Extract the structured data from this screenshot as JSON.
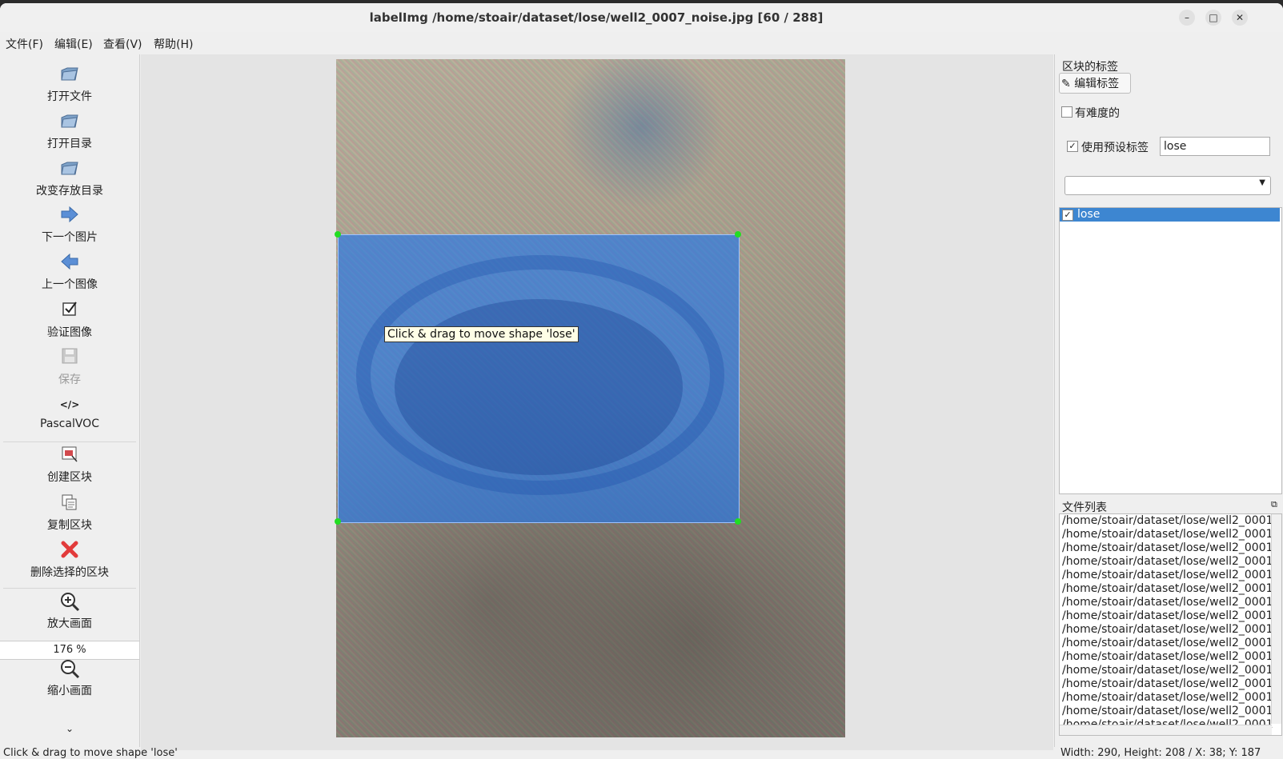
{
  "window": {
    "title": "labelImg /home/stoair/dataset/lose/well2_0007_noise.jpg [60 / 288]",
    "minimize_icon": "–",
    "maximize_icon": "□",
    "close_icon": "✕"
  },
  "menu": [
    "文件(F)",
    "编辑(E)",
    "查看(V)",
    "帮助(H)"
  ],
  "toolbar": {
    "open_file": {
      "label": "打开文件",
      "icon": "folder-icon"
    },
    "open_dir": {
      "label": "打开目录",
      "icon": "folder-icon"
    },
    "change_save_dir": {
      "label": "改变存放目录",
      "icon": "folder-icon"
    },
    "next_image": {
      "label": "下一个图片",
      "icon": "arrow-right-icon"
    },
    "prev_image": {
      "label": "上一个图像",
      "icon": "arrow-left-icon"
    },
    "verify": {
      "label": "验证图像",
      "icon": "checkbox-icon"
    },
    "save": {
      "label": "保存",
      "icon": "save-icon"
    },
    "format": {
      "label": "PascalVOC",
      "icon": "</>"
    },
    "create_box": {
      "label": "创建区块",
      "icon": "create-box-icon"
    },
    "duplicate_box": {
      "label": "复制区块",
      "icon": "copy-icon"
    },
    "delete_box": {
      "label": "删除选择的区块",
      "icon": "delete-icon"
    },
    "zoom_in": {
      "label": "放大画面",
      "icon": "zoom-in-icon"
    },
    "zoom_value": "176 %",
    "zoom_out": {
      "label": "缩小画面",
      "icon": "zoom-out-icon"
    },
    "more_icon": "⌄"
  },
  "canvas": {
    "tooltip": "Click & drag to move shape 'lose'",
    "box_color": "#2878e6"
  },
  "right_panel": {
    "box_labels_title": "区块的标签",
    "edit_label_button": "编辑标签",
    "difficult_label": "有难度的",
    "difficult_checked": false,
    "use_default_label": "使用预设标签",
    "use_default_checked": true,
    "default_label_value": "lose",
    "combo_value": "",
    "labels": [
      {
        "text": "lose",
        "checked": true,
        "selected": true
      }
    ],
    "file_list_title": "文件列表",
    "files": [
      "/home/stoair/dataset/lose/well2_0001",
      "/home/stoair/dataset/lose/well2_0001",
      "/home/stoair/dataset/lose/well2_0001",
      "/home/stoair/dataset/lose/well2_0001",
      "/home/stoair/dataset/lose/well2_0001",
      "/home/stoair/dataset/lose/well2_0001",
      "/home/stoair/dataset/lose/well2_0001",
      "/home/stoair/dataset/lose/well2_0001",
      "/home/stoair/dataset/lose/well2_0001",
      "/home/stoair/dataset/lose/well2_0001",
      "/home/stoair/dataset/lose/well2_0001",
      "/home/stoair/dataset/lose/well2_0001",
      "/home/stoair/dataset/lose/well2_0001",
      "/home/stoair/dataset/lose/well2_0001",
      "/home/stoair/dataset/lose/well2_0001",
      "/home/stoair/dataset/lose/well2_0001"
    ]
  },
  "status": {
    "left": "Click & drag to move shape 'lose'",
    "right": "Width: 290, Height: 208 / X: 38; Y: 187"
  }
}
